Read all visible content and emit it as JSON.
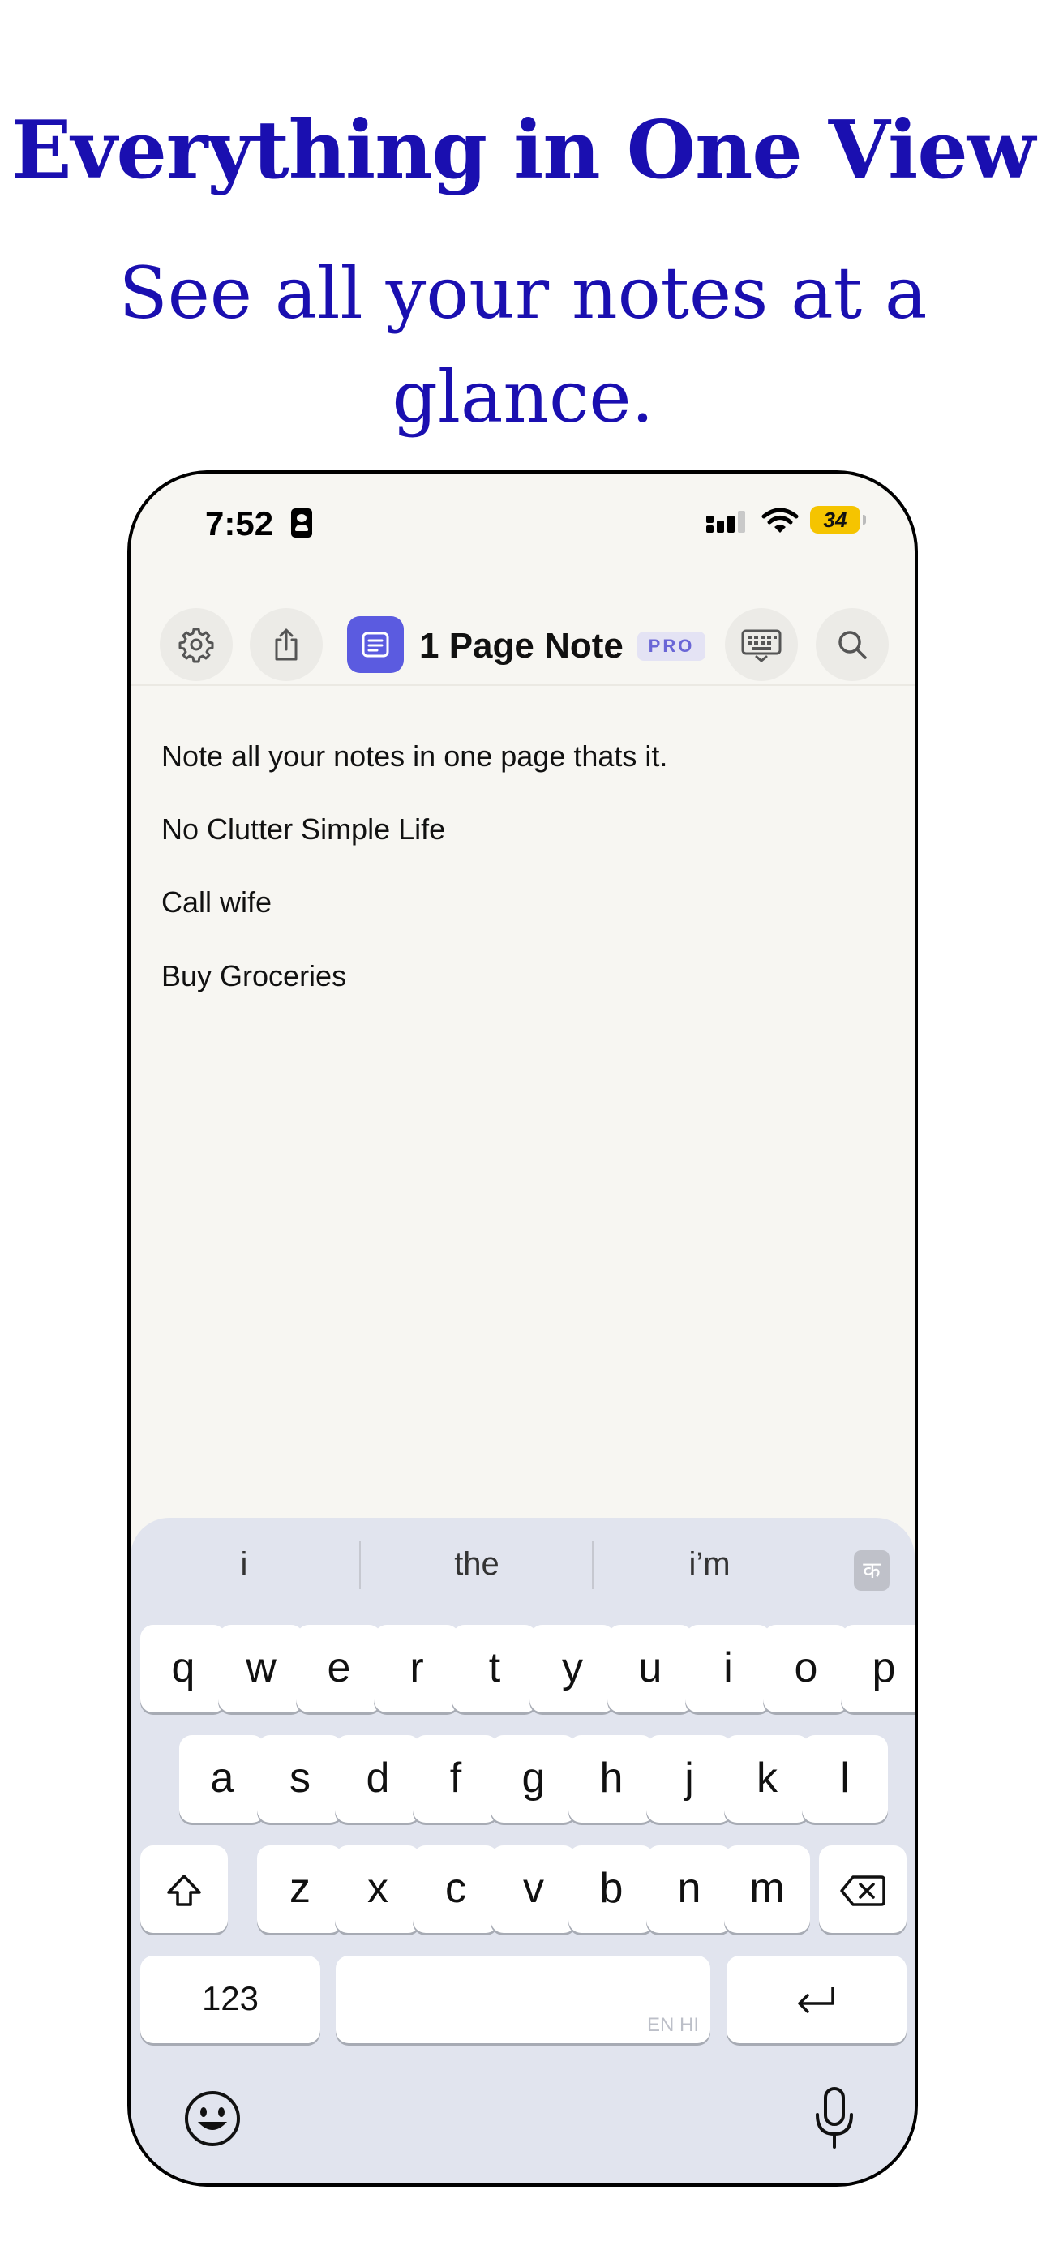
{
  "promo": {
    "headline": "Everything in One View",
    "subline": "See all your notes at a glance."
  },
  "status_bar": {
    "time": "7:52",
    "battery": "34"
  },
  "toolbar": {
    "settings_icon": "gear-icon",
    "share_icon": "share-icon",
    "app_title": "1 Page Note",
    "pro_badge": "PRO",
    "keyboard_icon": "keyboard-icon",
    "search_icon": "search-icon"
  },
  "note": {
    "lines": [
      "Note all your notes in one page thats it.",
      "No Clutter Simple Life",
      "Call wife",
      "Buy Groceries"
    ]
  },
  "keyboard": {
    "suggestions": [
      "i",
      "the",
      "i’m"
    ],
    "script_key": "क",
    "row1": [
      "q",
      "w",
      "e",
      "r",
      "t",
      "y",
      "u",
      "i",
      "o",
      "p"
    ],
    "row2": [
      "a",
      "s",
      "d",
      "f",
      "g",
      "h",
      "j",
      "k",
      "l"
    ],
    "row3": [
      "z",
      "x",
      "c",
      "v",
      "b",
      "n",
      "m"
    ],
    "numbers_key": "123",
    "space_hint": "EN HI",
    "emoji_icon": "emoji-icon",
    "mic_icon": "microphone-icon",
    "shift_icon": "shift-icon",
    "delete_icon": "delete-icon",
    "return_icon": "return-icon"
  },
  "colors": {
    "promo_text": "#1a0fb0",
    "app_accent": "#5b5be0",
    "note_background": "#f7f6f2",
    "keyboard_background": "#e1e4ee",
    "battery": "#f5c400"
  }
}
